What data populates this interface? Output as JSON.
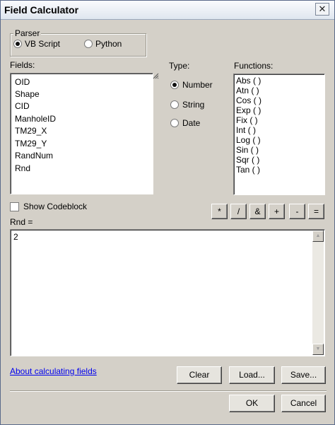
{
  "window": {
    "title": "Field Calculator",
    "close_glyph": "✕"
  },
  "parser": {
    "label": "Parser",
    "options": [
      {
        "label": "VB Script",
        "selected": true
      },
      {
        "label": "Python",
        "selected": false
      }
    ]
  },
  "fields": {
    "label": "Fields:",
    "items": [
      "OID",
      "Shape",
      "CID",
      "ManholeID",
      "TM29_X",
      "TM29_Y",
      "RandNum",
      "Rnd"
    ]
  },
  "type": {
    "label": "Type:",
    "options": [
      {
        "label": "Number",
        "selected": true
      },
      {
        "label": "String",
        "selected": false
      },
      {
        "label": "Date",
        "selected": false
      }
    ]
  },
  "functions": {
    "label": "Functions:",
    "items": [
      "Abs ( )",
      "Atn ( )",
      "Cos ( )",
      "Exp ( )",
      "Fix ( )",
      "Int ( )",
      "Log ( )",
      "Sin ( )",
      "Sqr ( )",
      "Tan ( )"
    ]
  },
  "codeblock": {
    "label": "Show Codeblock",
    "checked": false
  },
  "operators": [
    "*",
    "/",
    "&",
    "+",
    "-",
    "="
  ],
  "expression": {
    "label": "Rnd =",
    "value": "2"
  },
  "buttons": {
    "about": "About calculating fields",
    "clear": "Clear",
    "load": "Load...",
    "save": "Save...",
    "ok": "OK",
    "cancel": "Cancel"
  }
}
